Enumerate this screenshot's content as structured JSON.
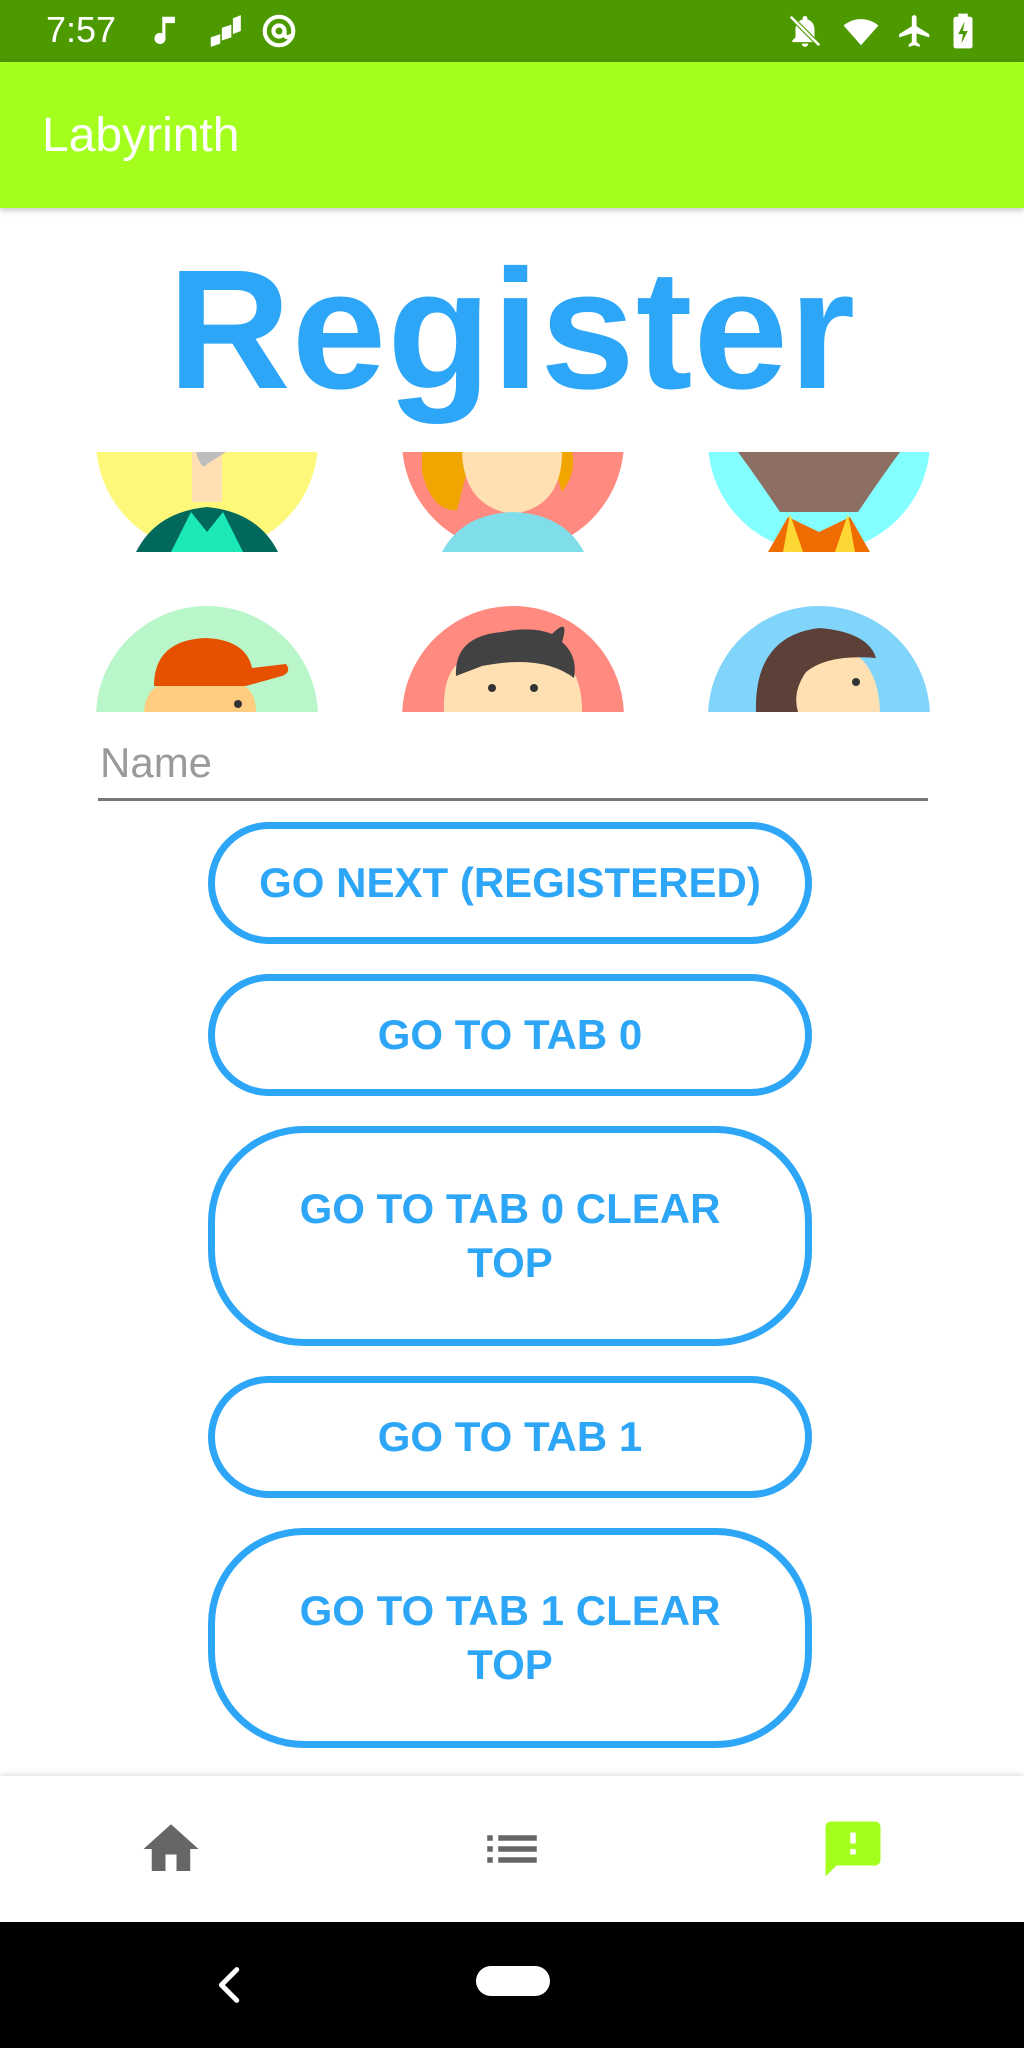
{
  "status_bar": {
    "time": "7:57",
    "left_icons": [
      "music-note-icon",
      "signal-bars-icon",
      "at-sign-icon"
    ],
    "right_icons": [
      "notifications-off-icon",
      "wifi-icon",
      "airplane-icon",
      "battery-charging-icon"
    ]
  },
  "app_bar": {
    "title": "Labyrinth"
  },
  "main": {
    "heading": "Register",
    "avatars": [
      {
        "name": "avatar-grey-hair",
        "bg": "#fdf77a"
      },
      {
        "name": "avatar-orange-hair",
        "bg": "#ff8a80"
      },
      {
        "name": "avatar-dark-skin",
        "bg": "#84ffff"
      },
      {
        "name": "avatar-red-cap",
        "bg": "#b9f6ca"
      },
      {
        "name": "avatar-black-hair-boy",
        "bg": "#ff8a80"
      },
      {
        "name": "avatar-brown-hair-girl",
        "bg": "#81d4fa"
      }
    ],
    "name_input": {
      "placeholder": "Name",
      "value": ""
    },
    "buttons": {
      "go_next": "GO NEXT (REGISTERED)",
      "go_tab0": "GO TO TAB 0",
      "go_tab0_clear_top": "GO TO TAB 0 CLEAR TOP",
      "go_tab1": "GO TO TAB 1",
      "go_tab1_clear_top": "GO TO TAB 1 CLEAR TOP"
    }
  },
  "bottom_nav": {
    "items": [
      {
        "icon": "home-icon",
        "selected": false
      },
      {
        "icon": "list-icon",
        "selected": false
      },
      {
        "icon": "feedback-icon",
        "selected": true
      }
    ],
    "selected_color": "#a4ff1f",
    "unselected_color": "#666666"
  },
  "colors": {
    "status_bar": "#4c9a00",
    "app_bar": "#a4ff1f",
    "accent": "#2ea6f7"
  }
}
